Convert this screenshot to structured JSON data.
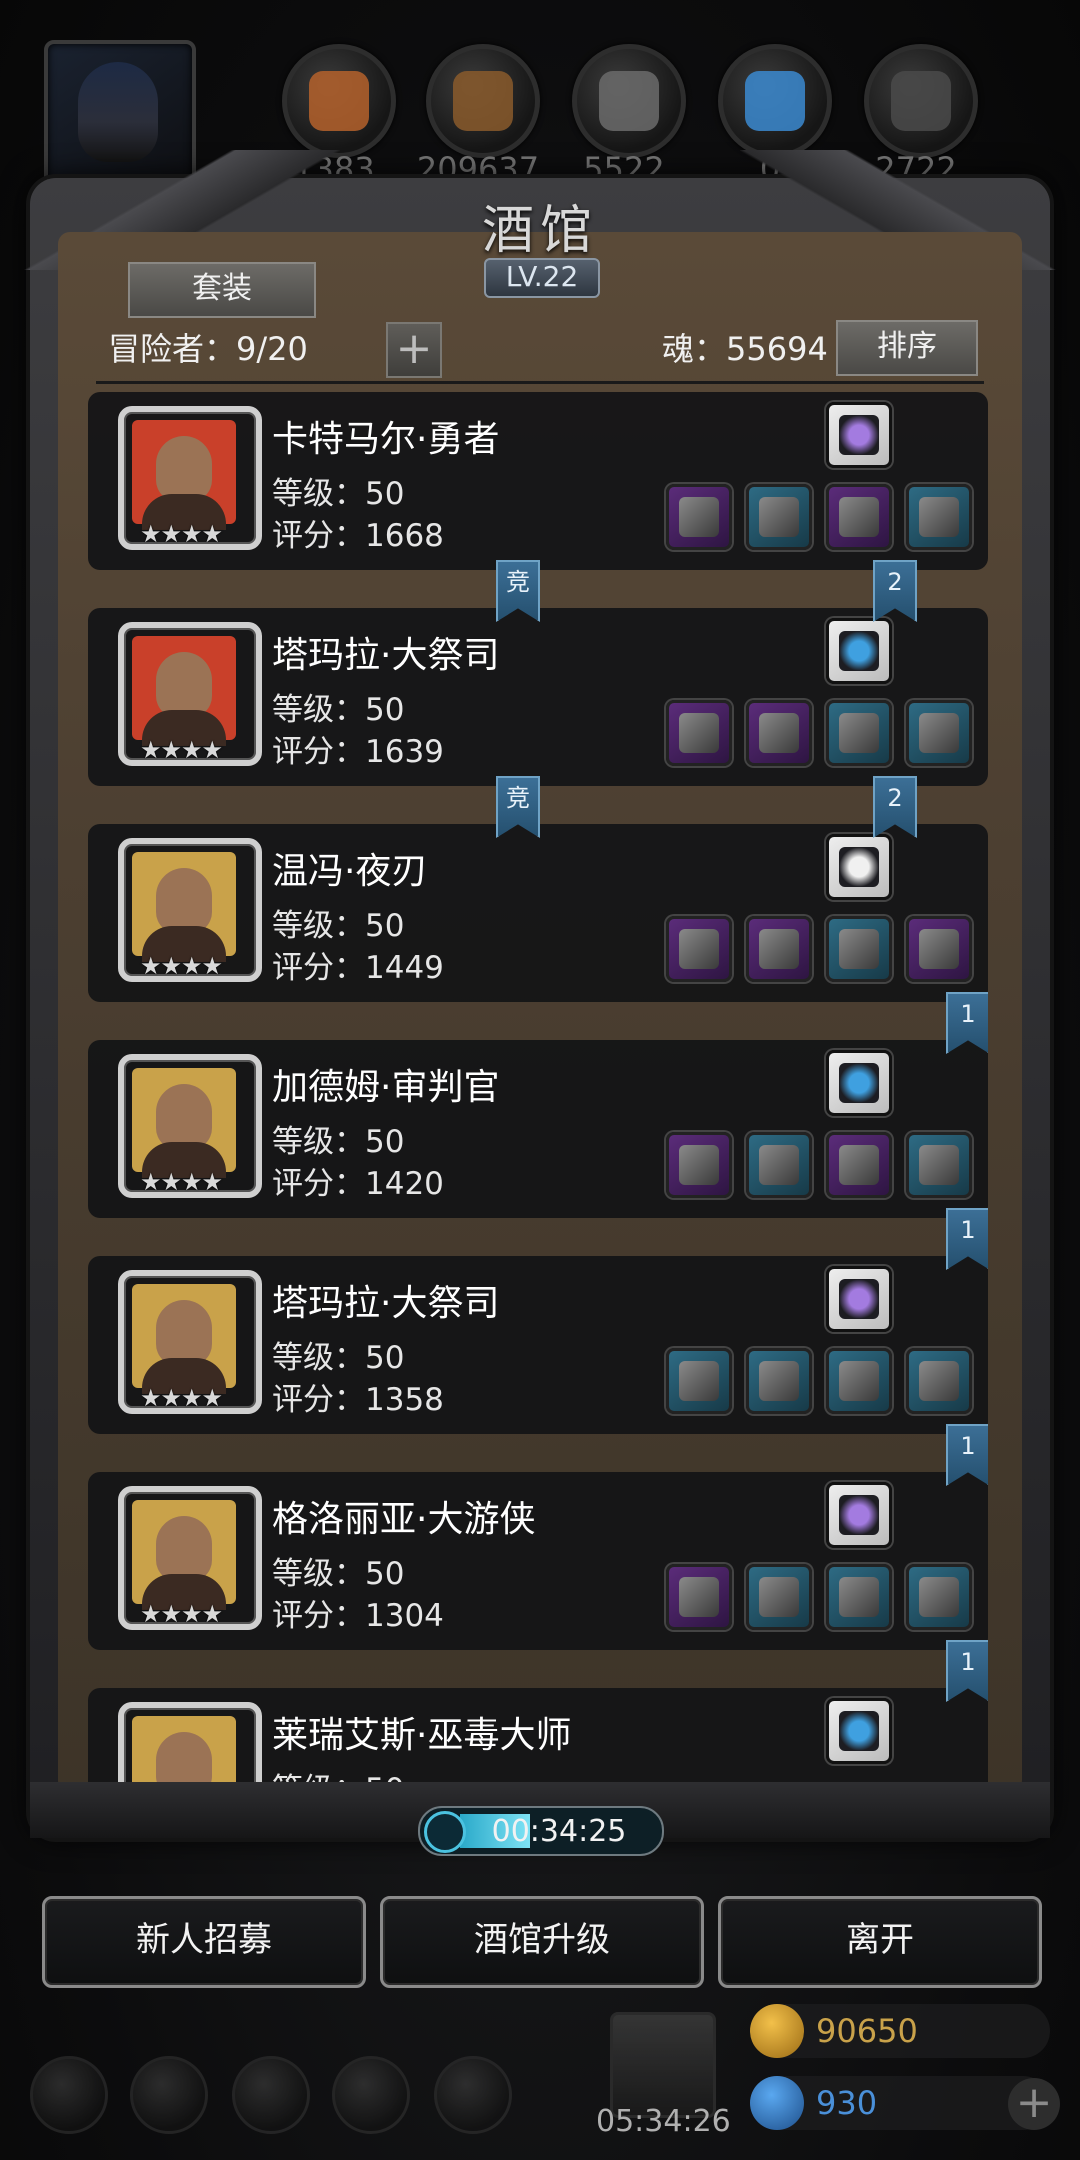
{
  "colors": {
    "ribbon": "#3c6f96",
    "slot_purple": "#5b2c7a",
    "slot_blue": "#2e6b84",
    "gold": "#c9a24a"
  },
  "resources": [
    {
      "name": "food-icon",
      "value": "1383",
      "color": "#b5622b"
    },
    {
      "name": "wood-icon",
      "value": "209637",
      "color": "#8a5a2c"
    },
    {
      "name": "iron-icon",
      "value": "5522",
      "color": "#6b6b6b"
    },
    {
      "name": "crystal-icon",
      "value": "0",
      "color": "#3b8ad0"
    },
    {
      "name": "ore-icon",
      "value": "2722",
      "color": "#4a4a4a"
    }
  ],
  "header": {
    "title": "酒馆",
    "level": "LV.22"
  },
  "toolbar": {
    "set_label": "套装",
    "adventurers": "冒险者：9/20",
    "plus": "+",
    "soul": "魂：55694",
    "sort_label": "排序"
  },
  "heroes": [
    {
      "name": "卡特马尔·勇者",
      "level": "等级：50",
      "score": "评分：1668",
      "stars": "★★★★",
      "frame": "#c9402a",
      "rune": "#a37be0",
      "slots": [
        "purple",
        "blue",
        "purple",
        "blue"
      ]
    },
    {
      "name": "塔玛拉·大祭司",
      "level": "等级：50",
      "score": "评分：1639",
      "stars": "★★★★",
      "frame": "#c9402a",
      "rune": "#3fa0e0",
      "slots": [
        "purple",
        "purple",
        "blue",
        "blue"
      ]
    },
    {
      "name": "温冯·夜刃",
      "level": "等级：50",
      "score": "评分：1449",
      "stars": "★★★★",
      "frame": "#c9a24a",
      "rune": "#f0f0f0",
      "slots": [
        "purple",
        "purple",
        "blue",
        "purple"
      ]
    },
    {
      "name": "加德姆·审判官",
      "level": "等级：50",
      "score": "评分：1420",
      "stars": "★★★★",
      "frame": "#c9a24a",
      "rune": "#3fa0e0",
      "slots": [
        "purple",
        "blue",
        "purple",
        "blue"
      ]
    },
    {
      "name": "塔玛拉·大祭司",
      "level": "等级：50",
      "score": "评分：1358",
      "stars": "★★★★",
      "frame": "#c9a24a",
      "rune": "#a37be0",
      "slots": [
        "blue",
        "blue",
        "blue",
        "blue"
      ]
    },
    {
      "name": "格洛丽亚·大游侠",
      "level": "等级：50",
      "score": "评分：1304",
      "stars": "★★★★",
      "frame": "#c9a24a",
      "rune": "#a37be0",
      "slots": [
        "purple",
        "blue",
        "blue",
        "blue"
      ]
    },
    {
      "name": "莱瑞艾斯·巫毒大师",
      "level": "等级：50",
      "score": "评分：",
      "stars": "★★★★",
      "frame": "#c9a24a",
      "rune": "#3fa0e0",
      "slots": []
    }
  ],
  "ribbons": [
    {
      "text": "竞"
    },
    {
      "text": "2"
    },
    {
      "text": "竞"
    },
    {
      "text": "2"
    },
    {
      "text": "1"
    },
    {
      "text": "1"
    },
    {
      "text": "1"
    },
    {
      "text": "1"
    }
  ],
  "timer": {
    "text": "00:34:25",
    "progress": 0.35
  },
  "buttons": {
    "recruit": "新人招募",
    "upgrade": "酒馆升级",
    "leave": "离开"
  },
  "dock": {
    "gift_timer": "05:34:26",
    "gold": "90650",
    "gems": "930",
    "plus": "+"
  }
}
